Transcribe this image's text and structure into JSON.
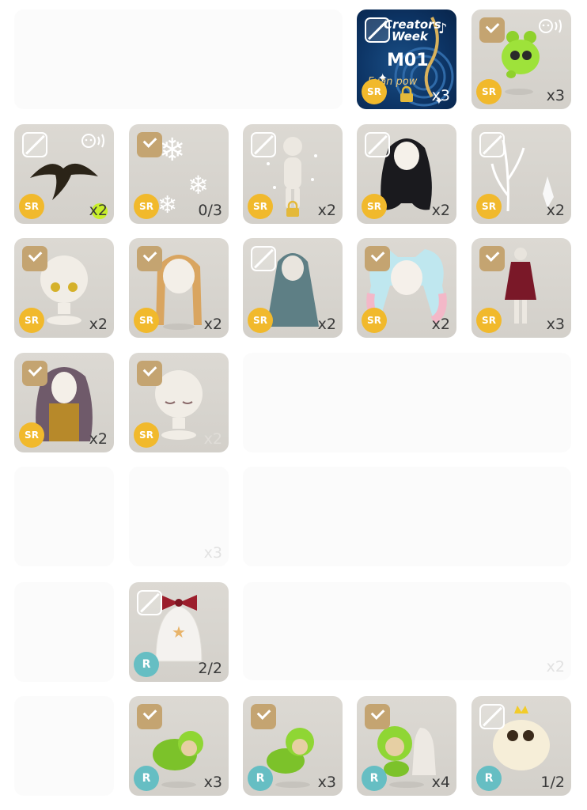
{
  "items": {
    "t1": {
      "name": "creators-week-card",
      "check": "off",
      "rarity": "SR",
      "count": "x3",
      "title_line1": "Creators",
      "title_line2": "Week",
      "code": "M01",
      "sub": "Fuan pow"
    },
    "t2": {
      "name": "green-creature",
      "check": "on",
      "rarity": "SR",
      "count": "x3"
    },
    "t3": {
      "name": "dark-tentacle",
      "check": "off",
      "rarity": "SR",
      "count": "x2"
    },
    "t4": {
      "name": "snowflakes",
      "check": "on",
      "rarity": "SR",
      "count": "0/3"
    },
    "t5": {
      "name": "sparkle-body",
      "check": "off",
      "rarity": "SR",
      "count": "x2"
    },
    "t6": {
      "name": "black-wavy-hair",
      "check": "off",
      "rarity": "SR",
      "count": "x2"
    },
    "t7": {
      "name": "ice-crystal-branch",
      "check": "off",
      "rarity": "SR",
      "count": "x2"
    },
    "t8": {
      "name": "yellow-eyes-face",
      "check": "on",
      "rarity": "SR",
      "count": "x2"
    },
    "t9": {
      "name": "blonde-braids",
      "check": "on",
      "rarity": "SR",
      "count": "x2"
    },
    "t10": {
      "name": "teal-long-hair",
      "check": "off",
      "rarity": "SR",
      "count": "x2"
    },
    "t11": {
      "name": "pastel-twintails",
      "check": "on",
      "rarity": "SR",
      "count": "x2"
    },
    "t12": {
      "name": "red-dress",
      "check": "on",
      "rarity": "SR",
      "count": "x3"
    },
    "t13": {
      "name": "purple-wavy-outfit",
      "check": "on",
      "rarity": "SR",
      "count": "x2"
    },
    "t14": {
      "name": "blush-face",
      "check": "on",
      "rarity": "SR",
      "count": "x2"
    },
    "t15": {
      "name": "bell-with-bow",
      "check": "off",
      "rarity": "R",
      "count": "2/2"
    },
    "t16": {
      "name": "green-pet-1",
      "check": "on",
      "rarity": "R",
      "count": "x3"
    },
    "t17": {
      "name": "green-pet-2",
      "check": "on",
      "rarity": "R",
      "count": "x3"
    },
    "t18": {
      "name": "green-pet-3",
      "check": "on",
      "rarity": "R",
      "count": "x4"
    },
    "t19": {
      "name": "fluffy-crown-pet",
      "check": "off",
      "rarity": "R",
      "count": "1/2"
    }
  },
  "ghost_counts": {
    "g1": "x3",
    "g2": "x2"
  },
  "colors": {
    "checked": "#c4a471",
    "sr": "#f1b92c",
    "r": "#66bec3",
    "tile": "#d8d5cf"
  }
}
